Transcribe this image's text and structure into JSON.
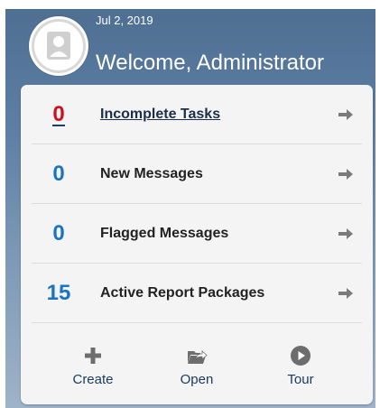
{
  "header": {
    "date": "Jul 2, 2019",
    "welcome": "Welcome, Administrator",
    "avatar_icon": "user-avatar-icon"
  },
  "summary": {
    "rows": [
      {
        "count": "0",
        "label": "Incomplete Tasks",
        "highlight": true,
        "icon": "arrow-right-icon"
      },
      {
        "count": "0",
        "label": "New Messages",
        "highlight": false,
        "icon": "arrow-right-icon"
      },
      {
        "count": "0",
        "label": "Flagged Messages",
        "highlight": false,
        "icon": "arrow-right-icon"
      },
      {
        "count": "15",
        "label": "Active Report Packages",
        "highlight": false,
        "icon": "arrow-right-icon"
      }
    ]
  },
  "actions": [
    {
      "label": "Create",
      "icon": "plus-icon"
    },
    {
      "label": "Open",
      "icon": "open-folder-icon"
    },
    {
      "label": "Tour",
      "icon": "play-circle-icon"
    }
  ],
  "colors": {
    "count_blue": "#1a74c5",
    "alert_red": "#d10f1c",
    "action_text": "#1b3b60",
    "icon_gray": "#6d6d6d"
  }
}
